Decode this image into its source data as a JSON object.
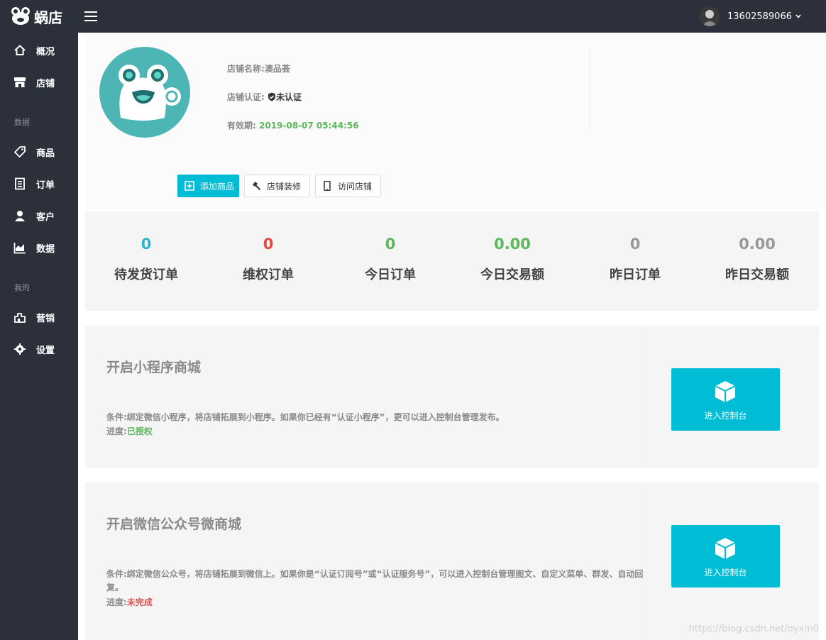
{
  "header": {
    "brand_name": "蜗店",
    "user_phone": "13602589066"
  },
  "sidebar": {
    "items": [
      {
        "label": "概况",
        "icon": "home-icon"
      },
      {
        "label": "店铺",
        "icon": "store-icon"
      },
      {
        "label": "商品",
        "icon": "tag-icon"
      },
      {
        "label": "订单",
        "icon": "order-icon"
      },
      {
        "label": "客户",
        "icon": "user-icon"
      },
      {
        "label": "数据",
        "icon": "chart-icon"
      },
      {
        "label": "营销",
        "icon": "marketing-icon"
      },
      {
        "label": "设置",
        "icon": "gear-icon"
      }
    ],
    "groups": [
      "数据",
      "我的"
    ]
  },
  "profile": {
    "name_label": "店铺名称:",
    "name_value": "澳品荟",
    "verify_label": "店铺认证:",
    "verify_value": "未认证",
    "expiry_label": "有效期:",
    "expiry_value": "2019-08-07 05:44:56"
  },
  "actions": {
    "add_product": "添加商品",
    "decorate": "店铺装修",
    "visit": "访问店铺"
  },
  "stats": [
    {
      "value": "0",
      "label": "待发货订单",
      "color": "#29b6cc"
    },
    {
      "value": "0",
      "label": "维权订单",
      "color": "#e8473f"
    },
    {
      "value": "0",
      "label": "今日订单",
      "color": "#5cb85c"
    },
    {
      "value": "0.00",
      "label": "今日交易额",
      "color": "#5cb85c"
    },
    {
      "value": "0",
      "label": "昨日订单",
      "color": "#999999"
    },
    {
      "value": "0.00",
      "label": "昨日交易额",
      "color": "#999999"
    }
  ],
  "panels": [
    {
      "title": "开启小程序商城",
      "condition": "条件:绑定微信小程序，将店铺拓展到小程序。如果你已经有“认证小程序”，更可以进入控制台管理发布。",
      "progress_label": "进度:",
      "progress_value": "已授权",
      "button": "进入控制台"
    },
    {
      "title": "开启微信公众号微商城",
      "condition": "条件:绑定微信公众号，将店铺拓展到微信上。如果你是“认证订阅号”或“认证服务号”，可以进入控制台管理图文、自定义菜单、群发、自动回复。",
      "progress_label": "进度:",
      "progress_value": "未完成",
      "button": "进入控制台"
    }
  ],
  "watermark": "https://blog.csdn.net/oyxm0"
}
